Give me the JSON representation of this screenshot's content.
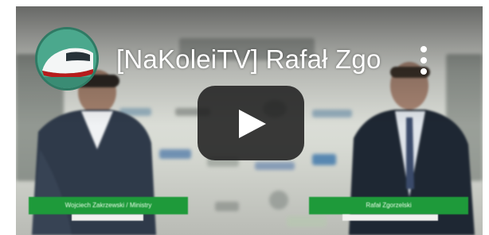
{
  "player": {
    "channel_avatar_icon": "train-icon",
    "title": "[NaKoleiTV] Rafał Zgo",
    "more_icon": "more-vert-icon",
    "play_icon": "play-icon",
    "colors": {
      "play_bg": "#212121",
      "nameplate": "#1e9a3a",
      "avatar": "#4ba88d"
    }
  },
  "lower_thirds": {
    "left_name": "Wojciech Zakrzewski / Ministry",
    "right_name": "Rafał Zgorzelski"
  }
}
